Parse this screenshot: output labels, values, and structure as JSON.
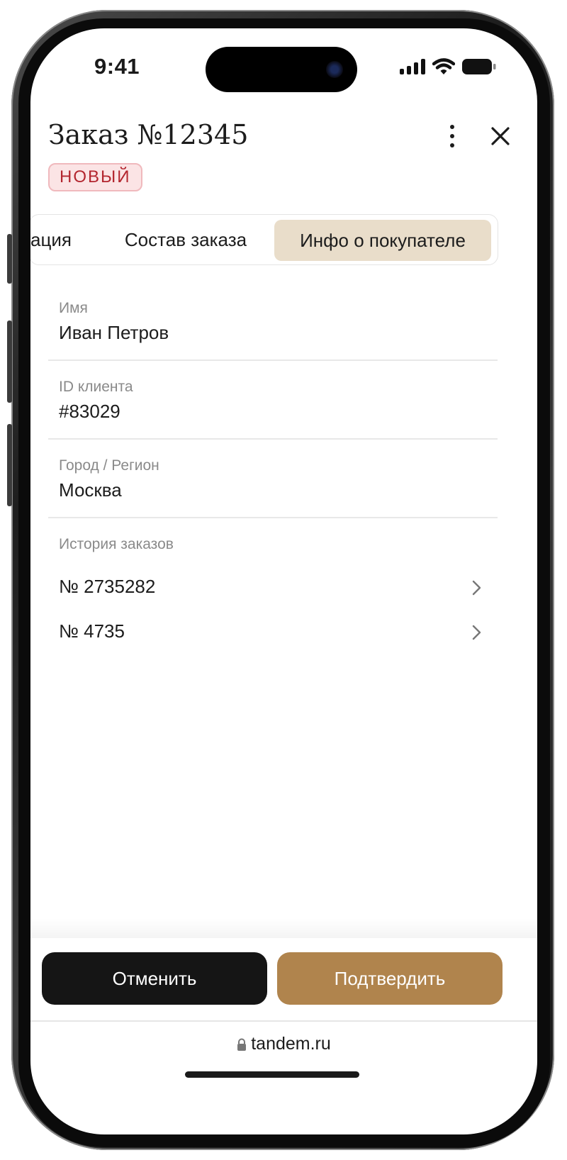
{
  "status_bar": {
    "time": "9:41"
  },
  "header": {
    "title": "Заказ №12345",
    "status_badge": "НОВЫЙ"
  },
  "tabs": [
    {
      "label": "ация",
      "active": false
    },
    {
      "label": "Состав заказа",
      "active": false
    },
    {
      "label": "Инфо о покупателе",
      "active": true
    }
  ],
  "customer": {
    "name_label": "Имя",
    "name_value": "Иван Петров",
    "id_label": "ID клиента",
    "id_value": "#83029",
    "city_label": "Город / Регион",
    "city_value": "Москва",
    "history_label": "История заказов",
    "history": [
      {
        "label": "№ 2735282"
      },
      {
        "label": "№ 4735"
      }
    ]
  },
  "actions": {
    "cancel_label": "Отменить",
    "confirm_label": "Подтвердить"
  },
  "browser": {
    "url": "tandem.ru"
  },
  "colors": {
    "accent": "#b0844d",
    "active_tab_bg": "#e9ddca",
    "badge_text": "#b3262f",
    "badge_bg": "#fbe4e5",
    "cancel_bg": "#151515"
  },
  "icons": [
    "signal-icon",
    "wifi-icon",
    "battery-icon",
    "more-vertical-icon",
    "close-icon",
    "chevron-right-icon",
    "lock-icon"
  ]
}
